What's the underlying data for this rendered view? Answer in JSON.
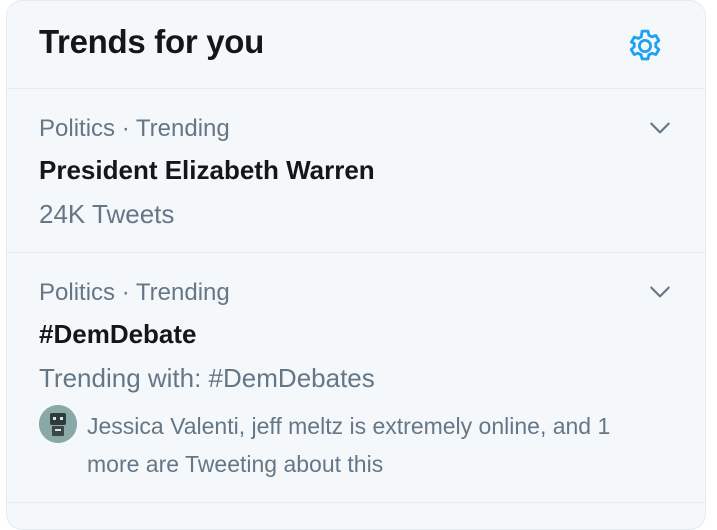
{
  "header": {
    "title": "Trends for you",
    "settings_icon": "gear-icon"
  },
  "trends": [
    {
      "meta": "Politics · Trending",
      "name": "President Elizabeth Warren",
      "sub": "24K Tweets",
      "chevron_icon": "chevron-down-icon"
    },
    {
      "meta": "Politics · Trending",
      "name": "#DemDebate",
      "sub": "Trending with: #DemDebates",
      "tweeting": "Jessica Valenti, jeff meltz is extremely online, and 1 more are Tweeting about this",
      "chevron_icon": "chevron-down-icon",
      "avatar_icon": "robot-avatar"
    }
  ],
  "colors": {
    "accent": "#1da1f2",
    "text_primary": "#14171a",
    "text_secondary": "#657786",
    "panel_bg": "#f5f8fa",
    "divider": "#e6ecf0"
  }
}
